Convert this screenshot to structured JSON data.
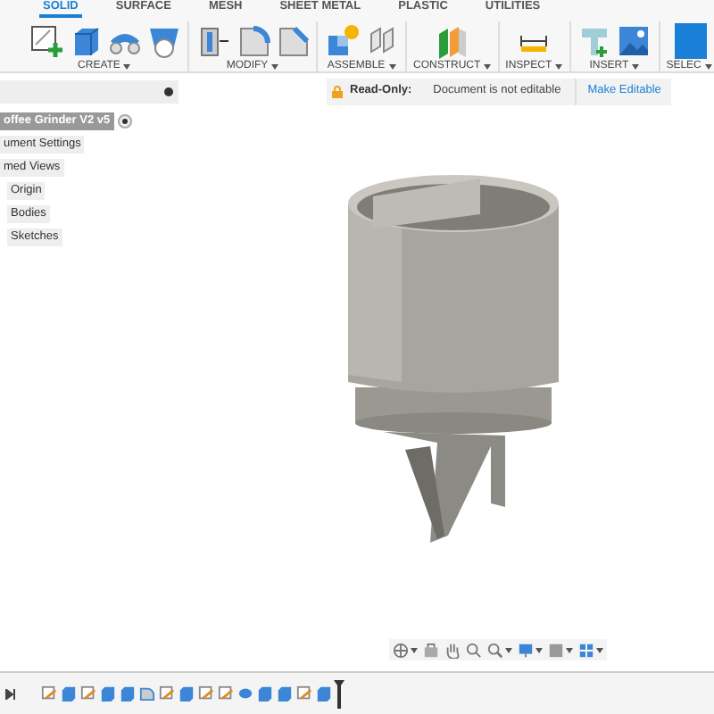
{
  "tabs": [
    {
      "label": "SOLID",
      "selected": true
    },
    {
      "label": "SURFACE",
      "selected": false
    },
    {
      "label": "MESH",
      "selected": false
    },
    {
      "label": "SHEET METAL",
      "selected": false
    },
    {
      "label": "PLASTIC",
      "selected": false
    },
    {
      "label": "UTILITIES",
      "selected": false
    }
  ],
  "groups": [
    {
      "label": "CREATE",
      "tools": [
        {
          "kind": "sketch"
        },
        {
          "kind": "box"
        },
        {
          "kind": "sweep"
        },
        {
          "kind": "hole"
        }
      ]
    },
    {
      "label": "MODIFY",
      "tools": [
        {
          "kind": "presspull"
        },
        {
          "kind": "fillet"
        },
        {
          "kind": "chamfer"
        }
      ]
    },
    {
      "label": "ASSEMBLE",
      "tools": [
        {
          "kind": "component"
        },
        {
          "kind": "joint"
        }
      ]
    },
    {
      "label": "CONSTRUCT",
      "tools": [
        {
          "kind": "plane"
        }
      ]
    },
    {
      "label": "INSPECT",
      "tools": [
        {
          "kind": "measure"
        }
      ]
    },
    {
      "label": "INSERT",
      "tools": [
        {
          "kind": "canvas"
        },
        {
          "kind": "image"
        }
      ]
    },
    {
      "label": "SELEC",
      "tools": [
        {
          "kind": "select"
        }
      ]
    }
  ],
  "banner": {
    "label": "Read-Only:",
    "message": "Document is not editable",
    "action": "Make Editable"
  },
  "browser": {
    "label": "offee Grinder V2 v5",
    "children": [
      {
        "label": "ument Settings"
      },
      {
        "label": "med Views"
      },
      {
        "label": "Origin"
      },
      {
        "label": "Bodies"
      },
      {
        "label": "Sketches"
      }
    ]
  },
  "navbar": [
    {
      "kind": "orbit",
      "menu": true
    },
    {
      "kind": "lookat",
      "menu": false
    },
    {
      "kind": "pan",
      "menu": false
    },
    {
      "kind": "zoomfit",
      "menu": false
    },
    {
      "kind": "zoom",
      "menu": true
    },
    {
      "kind": "display",
      "menu": true
    },
    {
      "kind": "visual",
      "menu": true
    },
    {
      "kind": "grid",
      "menu": true
    }
  ],
  "timeline": [
    {
      "kind": "sketch"
    },
    {
      "kind": "body"
    },
    {
      "kind": "sketch"
    },
    {
      "kind": "body"
    },
    {
      "kind": "body"
    },
    {
      "kind": "fillet"
    },
    {
      "kind": "sketch"
    },
    {
      "kind": "body"
    },
    {
      "kind": "sketch"
    },
    {
      "kind": "sketch"
    },
    {
      "kind": "revolve"
    },
    {
      "kind": "body"
    },
    {
      "kind": "body"
    },
    {
      "kind": "sketch"
    },
    {
      "kind": "body"
    }
  ]
}
